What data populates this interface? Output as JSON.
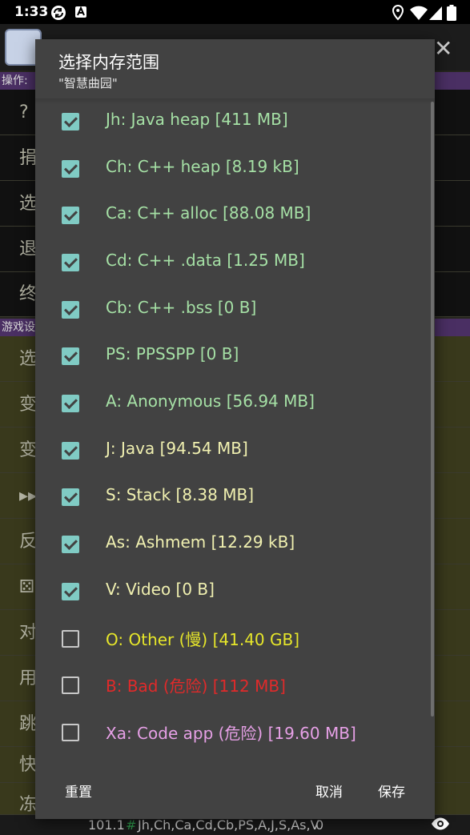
{
  "status_bar": {
    "time": "1:33"
  },
  "background": {
    "sections": [
      {
        "label": "操作:"
      },
      {
        "label": "游戏设"
      }
    ],
    "items": [
      {
        "label": "?"
      },
      {
        "label": "捐"
      },
      {
        "label": "选"
      },
      {
        "label": "退"
      },
      {
        "label": "终"
      },
      {
        "label": "选"
      },
      {
        "label": "变"
      },
      {
        "label": "变"
      },
      {
        "label": "▸▸"
      },
      {
        "label": "反"
      },
      {
        "label": "⚄"
      },
      {
        "label": "对"
      },
      {
        "label": "用"
      },
      {
        "label": "跳"
      },
      {
        "label": "快"
      },
      {
        "label": "冻"
      }
    ],
    "bottom_bar": {
      "value": "101.1",
      "hash": "#",
      "ranges": "Jh,Ch,Ca,Cd,Cb,PS,A,J,S,As,V",
      "count": "0"
    }
  },
  "dialog": {
    "title": "选择内存范围",
    "subtitle": "\"智慧曲园\"",
    "items": [
      {
        "label": "Jh: Java heap [411 MB]",
        "checked": true,
        "color": "#a5e0a5"
      },
      {
        "label": "Ch: C++ heap [8.19 kB]",
        "checked": true,
        "color": "#a5e0a5"
      },
      {
        "label": "Ca: C++ alloc [88.08 MB]",
        "checked": true,
        "color": "#a5e0a5"
      },
      {
        "label": "Cd: C++ .data [1.25 MB]",
        "checked": true,
        "color": "#a5e0a5"
      },
      {
        "label": "Cb: C++ .bss [0 B]",
        "checked": true,
        "color": "#a5e0a5"
      },
      {
        "label": "PS: PPSSPP [0 B]",
        "checked": true,
        "color": "#a5e0a5"
      },
      {
        "label": "A: Anonymous [56.94 MB]",
        "checked": true,
        "color": "#a5e0a5"
      },
      {
        "label": "J: Java [94.54 MB]",
        "checked": true,
        "color": "#f0f0b0"
      },
      {
        "label": "S: Stack [8.38 MB]",
        "checked": true,
        "color": "#f0f0b0"
      },
      {
        "label": "As: Ashmem [12.29 kB]",
        "checked": true,
        "color": "#f0f0b0"
      },
      {
        "label": "V: Video [0 B]",
        "checked": true,
        "color": "#f0f0b0"
      },
      {
        "label": "O: Other (慢) [41.40 GB]",
        "checked": false,
        "color": "#e6e62a"
      },
      {
        "label": "B: Bad (危险) [112 MB]",
        "checked": false,
        "color": "#e02a2a"
      },
      {
        "label": "Xa: Code app (危险) [19.60 MB]",
        "checked": false,
        "color": "#e6a0e6"
      }
    ],
    "buttons": {
      "reset": "重置",
      "cancel": "取消",
      "save": "保存"
    }
  }
}
